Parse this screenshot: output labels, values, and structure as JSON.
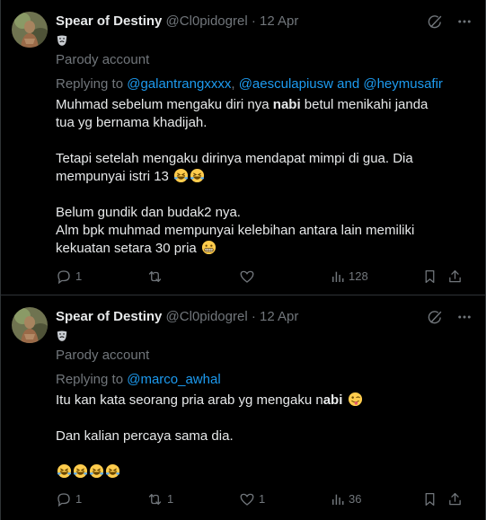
{
  "tweets": [
    {
      "display_name": "Spear of Destiny",
      "handle": "@Cl0pidogrel",
      "separator": "·",
      "date": "12 Apr",
      "parody_label": "Parody account",
      "replying_to_prefix": "Replying to ",
      "replying_to": [
        "@galantrangxxxx",
        "@aesculapiusw",
        "@heymusafir"
      ],
      "replying_to_joiners": [
        ", ",
        " and "
      ],
      "body": {
        "line1_pre": "Muhmad sebelum mengaku diri nya ",
        "line1_bold": "nabi",
        "line1_post": " betul menikahi janda",
        "line2": "tua yg bernama khadijah.",
        "line3": "Tetapi setelah mengaku dirinya mendapat mimpi di gua. Dia",
        "line4": "mempunyai istri 13",
        "line5": "Belum gundik dan budak2 nya.",
        "line6": "Alm bpk muhmad mempunyai kelebihan antara lain memiliki",
        "line7": "kekuatan setara 30 pria"
      },
      "actions": {
        "replies": "1",
        "reposts": "",
        "likes": "",
        "views": "128"
      }
    },
    {
      "display_name": "Spear of Destiny",
      "handle": "@Cl0pidogrel",
      "separator": "·",
      "date": "12 Apr",
      "parody_label": "Parody account",
      "replying_to_prefix": "Replying to ",
      "replying_to": [
        "@marco_awhal"
      ],
      "body": {
        "line1_pre": "Itu kan kata seorang pria arab yg mengaku n",
        "line1_bold": "abi",
        "line2": "Dan kalian percaya sama dia."
      },
      "actions": {
        "replies": "1",
        "reposts": "1",
        "likes": "1",
        "views": "36"
      }
    }
  ],
  "icons": {
    "grok": "grok-icon",
    "more": "more-icon",
    "mask": "performing-arts-mask-icon",
    "reply": "reply-icon",
    "repost": "repost-icon",
    "like": "heart-icon",
    "views": "views-chart-icon",
    "bookmark": "bookmark-icon",
    "share": "share-icon",
    "emoji_laugh": "rolling-on-floor-laughing-emoji",
    "emoji_grimace": "grimacing-face-emoji",
    "emoji_wink_tongue": "winking-face-with-tongue-emoji"
  },
  "colors": {
    "background": "#000000",
    "text": "#e7e9ea",
    "muted": "#71767b",
    "link": "#1d9bf0",
    "divider": "#2f3336"
  }
}
